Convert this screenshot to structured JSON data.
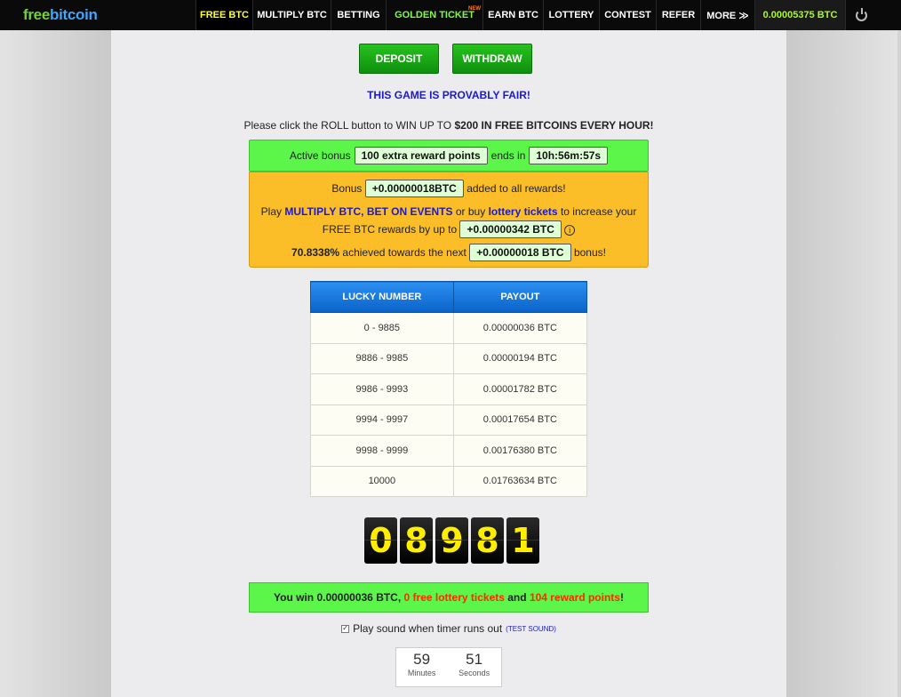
{
  "nav": {
    "logo_free": "free",
    "logo_bitcoin": "bitcoin",
    "items": [
      {
        "label": "FREE BTC"
      },
      {
        "label": "MULTIPLY BTC"
      },
      {
        "label": "BETTING"
      },
      {
        "label": "GOLDEN TICKET",
        "badge": "NEW"
      },
      {
        "label": "EARN BTC"
      },
      {
        "label": "LOTTERY"
      },
      {
        "label": "CONTEST"
      },
      {
        "label": "REFER"
      },
      {
        "label": "MORE ≫"
      }
    ],
    "balance": "0.00005375 BTC"
  },
  "buttons": {
    "deposit": "DEPOSIT",
    "withdraw": "WITHDRAW"
  },
  "provably_fair": "THIS GAME IS PROVABLY FAIR!",
  "intro": {
    "pre": "Please click the ROLL button to WIN UP TO ",
    "bold": "$200 IN FREE BITCOINS EVERY HOUR!"
  },
  "active_bonus": {
    "label": "Active bonus",
    "value": "100 extra reward points",
    "ends_label": "ends in",
    "time": "10h:56m:57s"
  },
  "bonus_box": {
    "line1_pre": "Bonus",
    "line1_value": "+0.00000018BTC",
    "line1_post": "added to all rewards!",
    "line2_pre": "Play",
    "link_multiply": "MULTIPLY BTC",
    "comma": ",",
    "link_bet": "BET ON EVENTS",
    "or_buy": "or buy",
    "link_lottery": "lottery tickets",
    "line2_post": "to increase your",
    "line3_pre": "FREE BTC rewards by up to",
    "line3_value": "+0.00000342 BTC",
    "info_glyph": "i",
    "line4_percent": "70.8338%",
    "line4_mid": "achieved towards the next",
    "line4_value": "+0.00000018 BTC",
    "line4_post": "bonus!"
  },
  "payout_table": {
    "headers": [
      "LUCKY NUMBER",
      "PAYOUT"
    ],
    "rows": [
      [
        "0 - 9885",
        "0.00000036 BTC"
      ],
      [
        "9886 - 9985",
        "0.00000194 BTC"
      ],
      [
        "9986 - 9993",
        "0.00001782 BTC"
      ],
      [
        "9994 - 9997",
        "0.00017654 BTC"
      ],
      [
        "9998 - 9999",
        "0.00176380 BTC"
      ],
      [
        "10000",
        "0.01763634 BTC"
      ]
    ]
  },
  "roll_digits": [
    "0",
    "8",
    "9",
    "8",
    "1"
  ],
  "win": {
    "pre": "You win 0.00000036 BTC, ",
    "lottery": "0 free lottery tickets",
    "and": " and ",
    "points": "104 reward points",
    "post": "!"
  },
  "sound": {
    "check": "✓",
    "label": "Play sound when timer runs out",
    "test": "(TEST SOUND)"
  },
  "timer": {
    "minutes": "59",
    "minutes_label": "Minutes",
    "seconds": "51",
    "seconds_label": "Seconds"
  },
  "colors": {
    "nav_bg": "#0a0a0a",
    "active_nav": "#ffff33",
    "golden": "#7cff3a",
    "balance": "#a6ff1a",
    "green_bar": "#5cf54a",
    "orange_box": "#fbbe28",
    "table_header": "#0a62c9",
    "digit_color": "#ffee00",
    "link_blue": "#1a1acc",
    "win_red": "#ff2a00"
  }
}
